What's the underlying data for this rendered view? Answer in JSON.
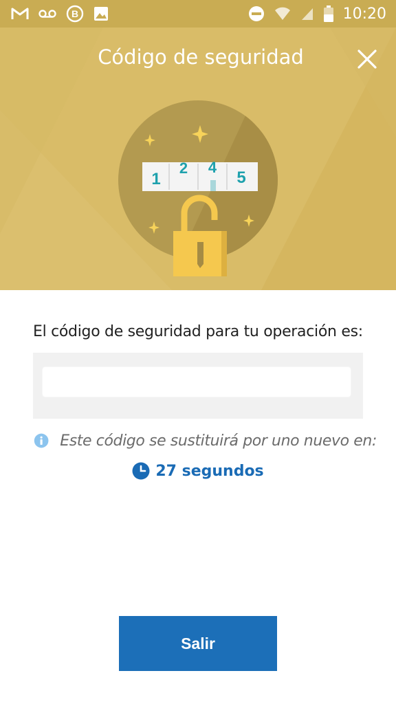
{
  "status_bar": {
    "time": "10:20",
    "left_icons": [
      "gmail-icon",
      "voicemail-icon",
      "b-app-icon",
      "image-icon"
    ],
    "right_icons": [
      "do-not-disturb-icon",
      "wifi-icon",
      "signal-icon",
      "battery-icon"
    ]
  },
  "header": {
    "title": "Código de seguridad",
    "close_icon": "close-icon"
  },
  "illustration": {
    "digits": [
      "1",
      "2",
      "4",
      "5"
    ]
  },
  "main": {
    "code_label": "El código de seguridad para tu operación es:",
    "code_value": "",
    "info_text": "Este código se sustituirá por uno nuevo en:",
    "timer_text": "27 segundos"
  },
  "footer": {
    "exit_label": "Salir"
  },
  "colors": {
    "hero": "#d9bc68",
    "primary": "#1c6fb8",
    "timer": "#1a6bb5",
    "info_icon": "#8cc4ee"
  }
}
